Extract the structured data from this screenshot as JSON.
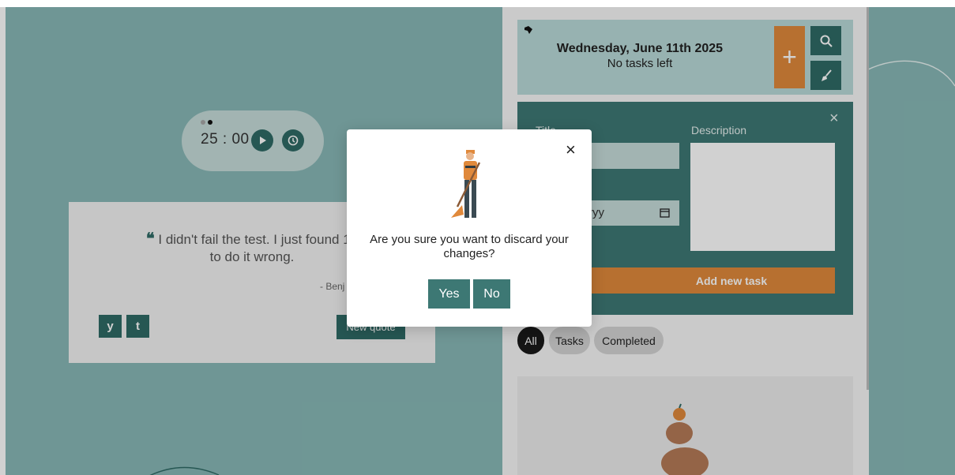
{
  "timer": {
    "time": "25 : 00",
    "play_icon": "play-icon",
    "reset_icon": "history-icon"
  },
  "quote": {
    "mark": "❝",
    "text": "I didn't fail the test. I just found 10",
    "text_line2": "to do it wrong.",
    "author": "- Benj",
    "new_quote_label": "New quote",
    "twitter_label": "y",
    "tumblr_label": "t"
  },
  "header": {
    "date": "Wednesday, June 11th 2025",
    "tasks_left": "No tasks left",
    "add_label": "+"
  },
  "form": {
    "title_label": "Title",
    "description_label": "Description",
    "date_placeholder": "yyyy",
    "add_task_label": "Add new task",
    "close_label": "×"
  },
  "filters": {
    "all": "All",
    "tasks": "Tasks",
    "completed": "Completed"
  },
  "modal": {
    "message": "Are you sure you want to discard your changes?",
    "yes_label": "Yes",
    "no_label": "No",
    "close_label": "×"
  },
  "colors": {
    "accent": "#3d7874",
    "orange": "#e0893b",
    "background": "#88b8b6"
  }
}
